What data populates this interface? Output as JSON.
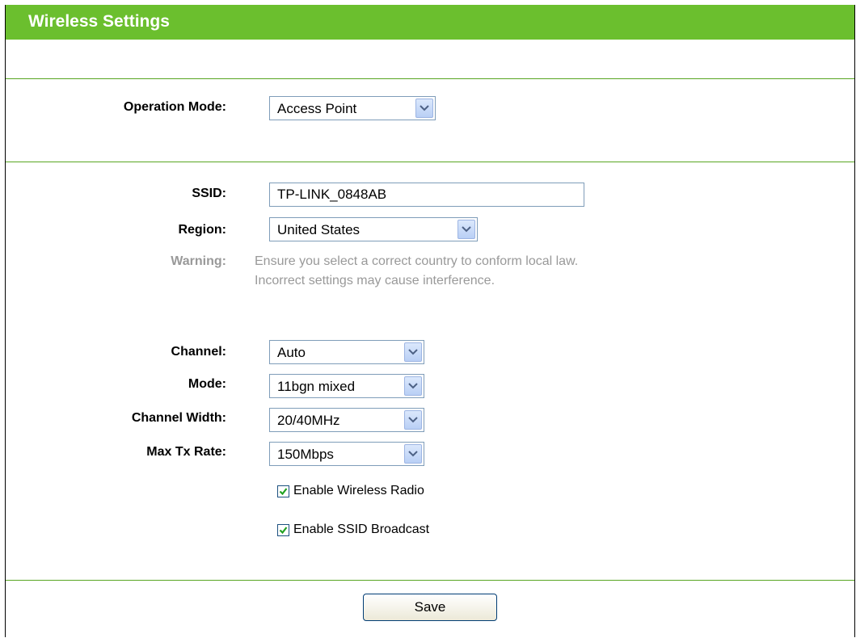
{
  "header": {
    "title": "Wireless Settings"
  },
  "operation_mode": {
    "label": "Operation Mode:",
    "value": "Access Point"
  },
  "ssid": {
    "label": "SSID:",
    "value": "TP-LINK_0848AB"
  },
  "region": {
    "label": "Region:",
    "value": "United States"
  },
  "warning": {
    "label": "Warning:",
    "line1": "Ensure you select a correct country to conform local law.",
    "line2": "Incorrect settings may cause interference."
  },
  "channel": {
    "label": "Channel:",
    "value": "Auto"
  },
  "mode": {
    "label": "Mode:",
    "value": "11bgn mixed"
  },
  "channel_width": {
    "label": "Channel Width:",
    "value": "20/40MHz"
  },
  "max_tx_rate": {
    "label": "Max Tx Rate:",
    "value": "150Mbps"
  },
  "enable_wireless_radio": {
    "label": "Enable Wireless Radio",
    "checked": true
  },
  "enable_ssid_broadcast": {
    "label": "Enable SSID Broadcast",
    "checked": true
  },
  "save_button": {
    "label": "Save"
  },
  "colors": {
    "header_bg": "#6bbf2e",
    "divider": "#58a622",
    "warning_text": "#999999"
  }
}
